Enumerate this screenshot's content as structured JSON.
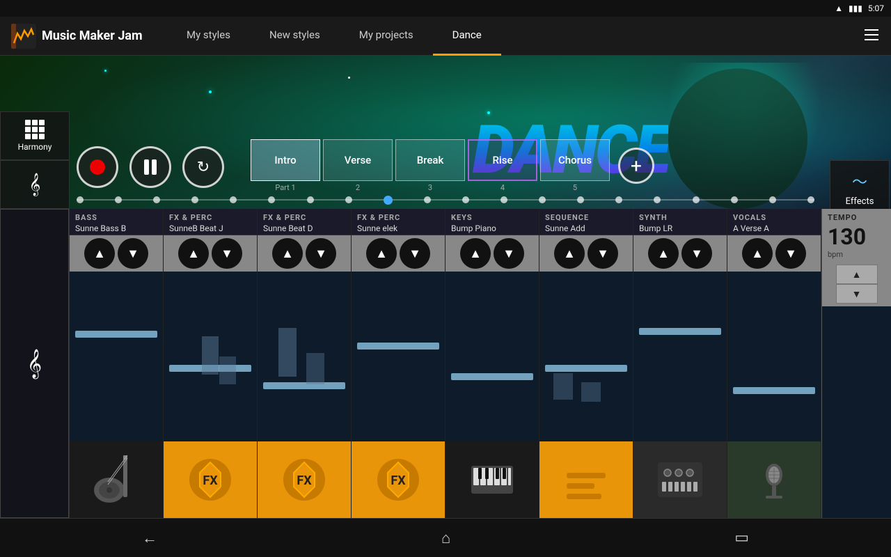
{
  "statusBar": {
    "time": "5:07",
    "battery": "▮▮▮",
    "wifi": "▲"
  },
  "nav": {
    "appName": "Music Maker Jam",
    "tabs": [
      {
        "id": "my-styles",
        "label": "My styles",
        "active": false
      },
      {
        "id": "new-styles",
        "label": "New styles",
        "active": false
      },
      {
        "id": "my-projects",
        "label": "My projects",
        "active": false
      },
      {
        "id": "dance",
        "label": "Dance",
        "active": true
      }
    ]
  },
  "transport": {
    "recordLabel": "Record",
    "pauseLabel": "Pause",
    "loopLabel": "Loop"
  },
  "parts": [
    {
      "id": "intro",
      "label": "Intro",
      "number": "Part 1",
      "active": true
    },
    {
      "id": "verse",
      "label": "Verse",
      "number": "2",
      "active": false
    },
    {
      "id": "break",
      "label": "Break",
      "number": "3",
      "active": false
    },
    {
      "id": "rise",
      "label": "Rise",
      "number": "4",
      "active": false,
      "highlighted": true
    },
    {
      "id": "chorus",
      "label": "Chorus",
      "number": "5",
      "active": false
    }
  ],
  "leftControls": {
    "harmonyLabel": "Harmony",
    "clefLabel": "♩"
  },
  "rightControls": {
    "effectsLabel": "Effects"
  },
  "channels": [
    {
      "id": "bass",
      "type": "BASS",
      "name": "Sunne Bass B",
      "iconType": "guitar"
    },
    {
      "id": "fxperc1",
      "type": "FX & PERC",
      "name": "SunneB Beat J",
      "iconType": "fx"
    },
    {
      "id": "fxperc2",
      "type": "FX & PERC",
      "name": "Sunne Beat D",
      "iconType": "fx"
    },
    {
      "id": "fxperc3",
      "type": "FX & PERC",
      "name": "Sunne elek",
      "iconType": "fx"
    },
    {
      "id": "keys",
      "type": "KEYS",
      "name": "Bump Piano",
      "iconType": "keys"
    },
    {
      "id": "sequence",
      "type": "SEQUENCE",
      "name": "Sunne Add",
      "iconType": "seq"
    },
    {
      "id": "synth",
      "type": "SYNTH",
      "name": "Bump LR",
      "iconType": "synth"
    },
    {
      "id": "vocals",
      "type": "VOCALS",
      "name": "A Verse A",
      "iconType": "vocals"
    }
  ],
  "tempo": {
    "label": "TEMPO",
    "value": "130",
    "unit": "bpm"
  },
  "bottomNav": {
    "backIcon": "←",
    "homeIcon": "⌂",
    "recentIcon": "▭"
  },
  "danceText": "DANCE",
  "timelineDots": 20,
  "activeTimelineDot": 8
}
